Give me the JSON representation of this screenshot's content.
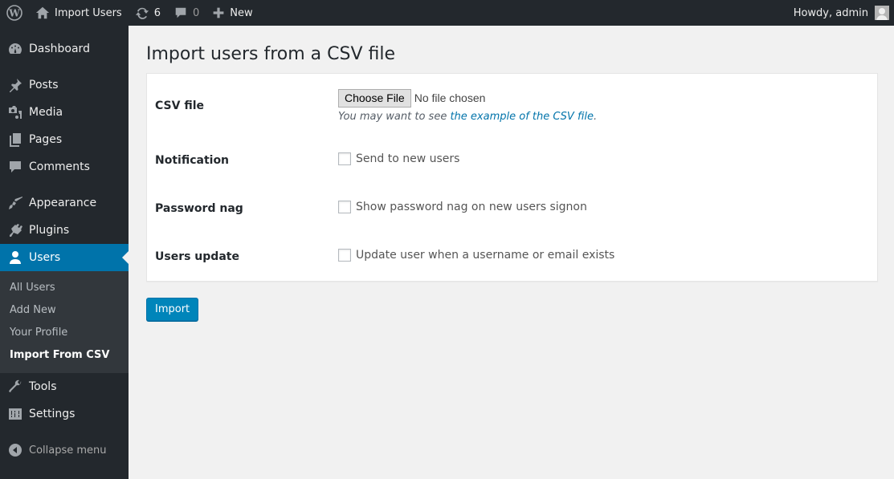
{
  "adminbar": {
    "site_name": "Import Users",
    "updates_count": "6",
    "comments_count": "0",
    "new_label": "New",
    "greeting": "Howdy, admin"
  },
  "sidebar": {
    "items": [
      {
        "label": "Dashboard",
        "icon": "dashboard-icon"
      },
      {
        "label": "Posts",
        "icon": "pin-icon"
      },
      {
        "label": "Media",
        "icon": "media-icon"
      },
      {
        "label": "Pages",
        "icon": "pages-icon"
      },
      {
        "label": "Comments",
        "icon": "comment-icon"
      },
      {
        "label": "Appearance",
        "icon": "brush-icon"
      },
      {
        "label": "Plugins",
        "icon": "plug-icon"
      },
      {
        "label": "Users",
        "icon": "user-icon"
      },
      {
        "label": "Tools",
        "icon": "wrench-icon"
      },
      {
        "label": "Settings",
        "icon": "sliders-icon"
      }
    ],
    "users_submenu": [
      "All Users",
      "Add New",
      "Your Profile",
      "Import From CSV"
    ],
    "collapse_label": "Collapse menu"
  },
  "page": {
    "title": "Import users from a CSV file",
    "fields": {
      "csv_file": {
        "label": "CSV file",
        "button": "Choose File",
        "status": "No file chosen",
        "desc_prefix": "You may want to see ",
        "desc_link": "the example of the CSV file",
        "desc_suffix": "."
      },
      "notification": {
        "label": "Notification",
        "checkbox_label": "Send to new users",
        "checked": false
      },
      "password_nag": {
        "label": "Password nag",
        "checkbox_label": "Show password nag on new users signon",
        "checked": false
      },
      "users_update": {
        "label": "Users update",
        "checkbox_label": "Update user when a username or email exists",
        "checked": false
      }
    },
    "import_button": "Import"
  },
  "colors": {
    "accent": "#0073aa",
    "button": "#0085ba",
    "sidebar": "#23282d"
  }
}
